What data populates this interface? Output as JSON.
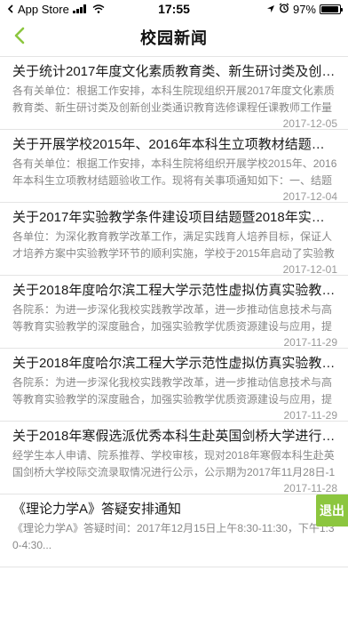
{
  "status_bar": {
    "carrier": "App Store",
    "time": "17:55",
    "battery": "97%",
    "battery_level": 0.97,
    "icons": [
      "signal-icon",
      "wifi-icon",
      "location-icon",
      "alarm-icon",
      "battery-icon"
    ]
  },
  "nav": {
    "title": "校园新闻",
    "back_icon": "chevron-left-icon"
  },
  "colors": {
    "accent": "#8cc63f"
  },
  "news": [
    {
      "title": "关于统计2017年度文化素质教育类、新生研讨类及创新创业类通识教育选修课程任课教师工作量的通知",
      "summary": "各有关单位：根据工作安排，本科生院现组织开展2017年度文化素质教育类、新生研讨类及创新创业类通识教育选修课程任课教师工作量的统计...",
      "date": "2017-12-05"
    },
    {
      "title": "关于开展学校2015年、2016年本科生立项教材结题验收工作的通知",
      "summary": "各有关单位：根据工作安排，本科生院将组织开展学校2015年、2016年本科生立项教材结题验收工作。现将有关事项通知如下：一、结题验收...",
      "date": "2017-12-04"
    },
    {
      "title": "关于2017年实验教学条件建设项目结题暨2018年实验教学条件建设项目申报的通知",
      "summary": "各单位：为深化教育教学改革工作，满足实践育人培养目标，保证人才培养方案中实验教学环节的顺利实施，学校于2015年启动了实验教学条件...",
      "date": "2017-12-01"
    },
    {
      "title": "关于2018年度哈尔滨工程大学示范性虚拟仿真实验教学项目申报工作的通知",
      "summary": "各院系：为进一步深化我校实践教学改革，进一步推动信息技术与高等教育实验教学的深度融合，加强实验教学优质资源建设与应用，提升实验教学质量...",
      "date": "2017-11-29"
    },
    {
      "title": "关于2018年度哈尔滨工程大学示范性虚拟仿真实验教学项目申报工作的通知",
      "summary": "各院系：为进一步深化我校实践教学改革，进一步推动信息技术与高等教育实验教学的深度融合，加强实验教学优质资源建设与应用，提升实验教学质量...",
      "date": "2017-11-29"
    },
    {
      "title": "关于2018年寒假选派优秀本科生赴英国剑桥大学进行校际交流的公示",
      "summary": "经学生本人申请、院系推荐、学校审核，现对2018年寒假本科生赴英国剑桥大学校际交流录取情况进行公示，公示期为2017年11月28日-12月...",
      "date": "2017-11-28"
    },
    {
      "title": "《理论力学A》答疑安排通知",
      "summary": "《理论力学A》答疑时间：2017年12月15日上午8:30-11:30，下午1:30-4:30...",
      "date": ""
    }
  ],
  "exit_button": {
    "label": "退出"
  }
}
